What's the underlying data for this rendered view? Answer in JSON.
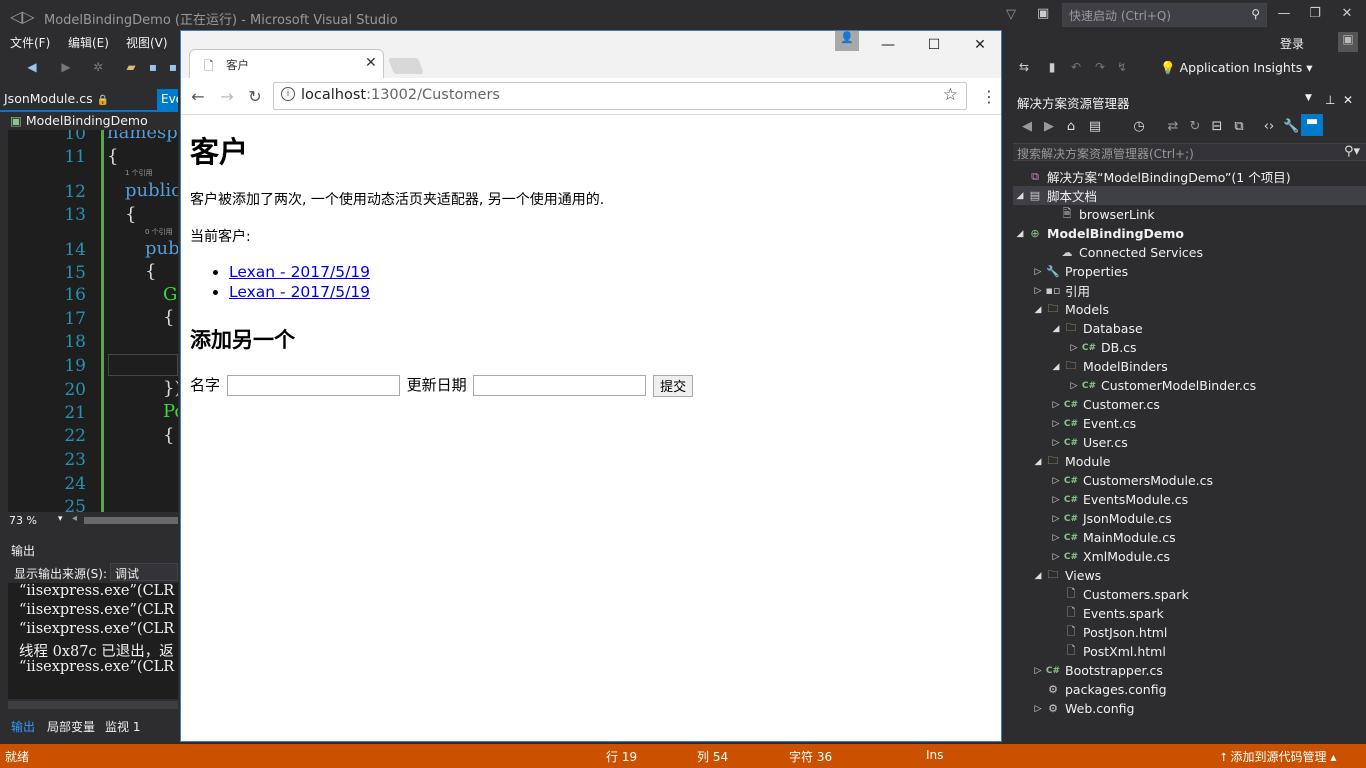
{
  "vs": {
    "title": "ModelBindingDemo (正在运行) - Microsoft Visual Studio",
    "quick_launch": "快速启动 (Ctrl+Q)",
    "login": "登录",
    "menu": [
      "文件(F)",
      "编辑(E)",
      "视图(V)"
    ],
    "app_insights": "Application Insights",
    "tab_json": "JsonModule.cs",
    "tab_eve": "Eve",
    "nav_project": "ModelBindingDemo",
    "zoom": "73 %",
    "output_title": "输出",
    "output_source_label": "显示输出来源(S):",
    "output_source_value": "调试",
    "output_lines": [
      "“iisexpress.exe”(CLR v",
      "“iisexpress.exe”(CLR v",
      "“iisexpress.exe”(CLR v",
      "线程 0x87c 已退出，返",
      "“iisexpress.exe”(CLR v"
    ],
    "bottom_tabs": [
      "输出",
      "局部变量",
      "监视 1"
    ]
  },
  "editor": {
    "lines": [
      "10",
      "11",
      "12",
      "13",
      "14",
      "15",
      "16",
      "17",
      "18",
      "19",
      "20",
      "21",
      "22",
      "23",
      "24",
      "25"
    ],
    "code": {
      "l10": "namespa",
      "l11": "{",
      "ref1": "1 个引用",
      "l12_kw": "public",
      "l13": "{",
      "ref2": "0 个引用",
      "l14_kw": "pub",
      "l15": "{",
      "l16": "G",
      "l17": "{",
      "l20": "});",
      "l21": "Po",
      "l22": "{"
    }
  },
  "browser": {
    "tab_title": "客户",
    "url_host": "localhost",
    "url_path": ":13002/Customers",
    "page": {
      "h1": "客户",
      "p1": "客户被添加了两次, 一个使用动态活页夹适配器, 另一个使用通用的.",
      "p2": "当前客户:",
      "customers": [
        "Lexan - 2017/5/19",
        "Lexan - 2017/5/19"
      ],
      "h2": "添加另一个",
      "name_label": "名字",
      "date_label": "更新日期",
      "submit": "提交"
    }
  },
  "solution_explorer": {
    "title": "解决方案资源管理器",
    "search_placeholder": "搜索解决方案资源管理器(Ctrl+;)",
    "solution": "解决方案“ModelBindingDemo”(1 个项目)",
    "script_docs": "脚本文档",
    "browserlink": "browserLink",
    "project": "ModelBindingDemo",
    "connected_services": "Connected Services",
    "properties": "Properties",
    "references": "引用",
    "models": "Models",
    "database": "Database",
    "db_cs": "DB.cs",
    "modelbinders": "ModelBinders",
    "customermodelbinder": "CustomerModelBinder.cs",
    "customer_cs": "Customer.cs",
    "event_cs": "Event.cs",
    "user_cs": "User.cs",
    "module": "Module",
    "customersmodule": "CustomersModule.cs",
    "eventsmodule": "EventsModule.cs",
    "jsonmodule": "JsonModule.cs",
    "mainmodule": "MainModule.cs",
    "xmlmodule": "XmlModule.cs",
    "views": "Views",
    "customers_spark": "Customers.spark",
    "events_spark": "Events.spark",
    "postjson": "PostJson.html",
    "postxml": "PostXml.html",
    "bootstrapper": "Bootstrapper.cs",
    "packages": "packages.config",
    "webconfig": "Web.config"
  },
  "status": {
    "ready": "就绪",
    "row": "行 19",
    "col": "列 54",
    "char": "字符 36",
    "ins": "Ins",
    "source_control": "添加到源代码管理"
  }
}
